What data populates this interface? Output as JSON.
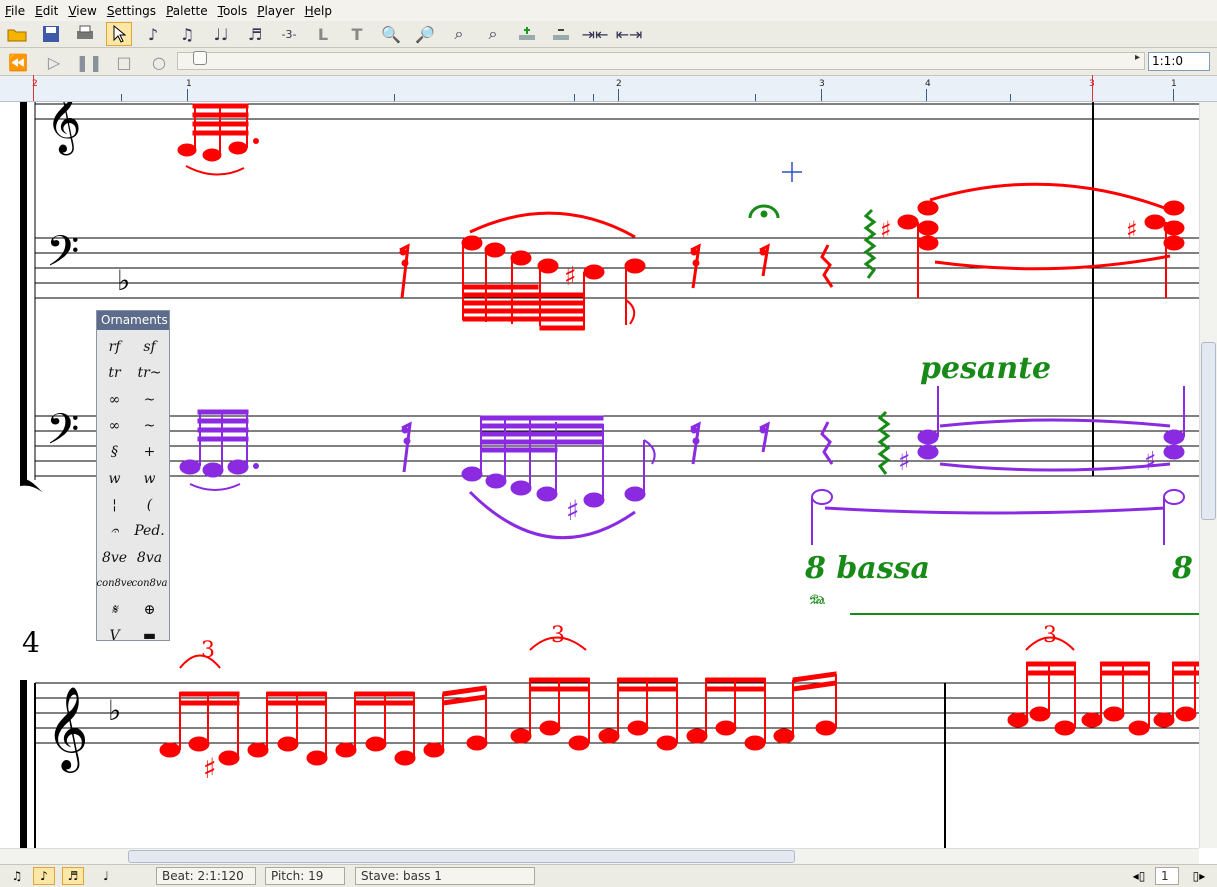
{
  "menu": [
    "File",
    "Edit",
    "View",
    "Settings",
    "Palette",
    "Tools",
    "Player",
    "Help"
  ],
  "toolbar_icons": [
    "open-folder-icon",
    "save-icon",
    "print-icon",
    "select-arrow-icon",
    "eighth-note-icon",
    "beamed-eighths-icon",
    "beamed-quarters-icon",
    "beamed-triplet-icon",
    "triplet-icon",
    "l-tool-icon",
    "text-tool-icon",
    "zoom-in-icon",
    "zoom-out-icon",
    "zoom-fit-icon",
    "zoom-page-icon",
    "add-staff-icon",
    "remove-staff-icon",
    "shrink-icon",
    "expand-icon"
  ],
  "player": {
    "position": "1:1:0"
  },
  "ruler": {
    "labels": [
      "2",
      "1",
      "2",
      "3",
      "4",
      "3",
      "1"
    ]
  },
  "score": {
    "measure_number": "4",
    "annotations": {
      "pesante": "pesante",
      "bassa": "8 bassa",
      "bassa_right": "8",
      "triplet": "3"
    }
  },
  "palette": {
    "title": "Ornaments",
    "items": [
      "rf",
      "sf",
      "tr",
      "tr~",
      "∞",
      "~",
      "∞",
      "~",
      "§",
      "+",
      "w",
      "w",
      "¦",
      "(",
      "𝄐",
      "Ped.",
      "8ve",
      "8va",
      "con8ve",
      "con8va",
      "𝄋",
      "⊕",
      "V",
      "▬"
    ]
  },
  "status": {
    "beat": "Beat:  2:1:120",
    "pitch": "Pitch:  19",
    "stave": "Stave:    bass 1",
    "page": "1"
  },
  "colors": {
    "red_part": "#ff0000",
    "purple_part": "#8a2be2",
    "green_part": "#188a18"
  }
}
